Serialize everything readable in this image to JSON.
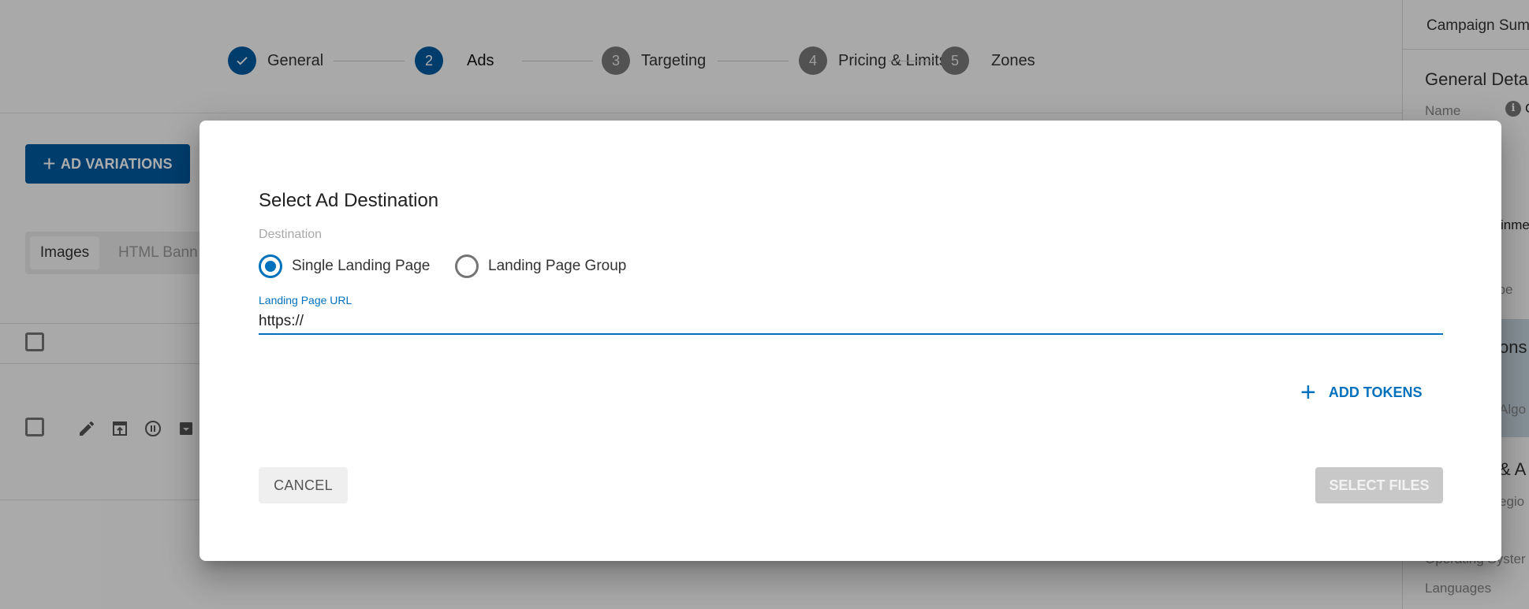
{
  "stepper": {
    "steps": [
      {
        "marker": "✓",
        "label": "General",
        "state": "done"
      },
      {
        "marker": "2",
        "label": "Ads",
        "state": "active"
      },
      {
        "marker": "3",
        "label": "Targeting",
        "state": "todo"
      },
      {
        "marker": "4",
        "label": "Pricing & Limits",
        "state": "todo"
      },
      {
        "marker": "5",
        "label": "Zones",
        "state": "todo"
      }
    ]
  },
  "ads": {
    "add_variations_label": "AD VARIATIONS",
    "add_icon": "plus-icon",
    "tabs": [
      {
        "label": "Images",
        "active": true
      },
      {
        "label": "HTML Bann",
        "active": false
      }
    ],
    "row_actions": [
      "edit-icon",
      "preview-icon",
      "pause-icon",
      "archive-icon"
    ]
  },
  "summary": {
    "title": "Campaign Sum",
    "general_details_heading": "General Detai",
    "name_key": "Name",
    "name_value": "C",
    "category_value_fragment": "inme",
    "type_fragment": "ype",
    "section_fragment": "ons",
    "algo_fragment": "Algo",
    "geo_heading_fragment": "& A",
    "region_fragment": "egio",
    "operating_systems": "Operating Syster",
    "languages": "Languages"
  },
  "dialog": {
    "title": "Select Ad Destination",
    "destination_label": "Destination",
    "radio_options": [
      {
        "label": "Single Landing Page",
        "checked": true
      },
      {
        "label": "Landing Page Group",
        "checked": false
      }
    ],
    "url_field": {
      "label": "Landing Page URL",
      "value": "https://"
    },
    "add_tokens_label": "ADD TOKENS",
    "cancel_label": "CANCEL",
    "select_files_label": "SELECT FILES",
    "select_files_enabled": false
  },
  "colors": {
    "primary": "#005b9f",
    "accent": "#0071bc",
    "disabled_button": "#c8c8c8"
  }
}
